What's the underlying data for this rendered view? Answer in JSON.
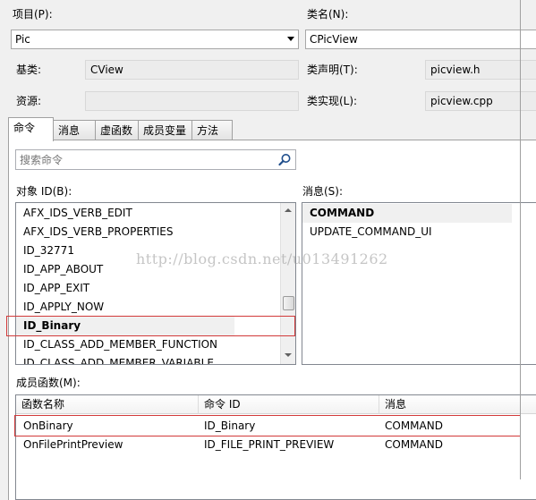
{
  "project": {
    "label": "项目(P):",
    "value": "Pic"
  },
  "class_name": {
    "label": "类名(N):",
    "value": "CPicView"
  },
  "base_class": {
    "label": "基类:",
    "value": "CView"
  },
  "class_decl": {
    "label": "类声明(T):",
    "value": "picview.h"
  },
  "resource": {
    "label": "资源:",
    "value": ""
  },
  "class_impl": {
    "label": "类实现(L):",
    "value": "picview.cpp"
  },
  "tabs": [
    {
      "label": "命令",
      "active": true
    },
    {
      "label": "消息"
    },
    {
      "label": "虚函数"
    },
    {
      "label": "成员变量"
    },
    {
      "label": "方法"
    }
  ],
  "search": {
    "placeholder": "搜索命令"
  },
  "object_ids": {
    "label": "对象 ID(B):",
    "items": [
      "AFX_IDS_VERB_EDIT",
      "AFX_IDS_VERB_PROPERTIES",
      "ID_32771",
      "ID_APP_ABOUT",
      "ID_APP_EXIT",
      "ID_APPLY_NOW",
      "ID_Binary",
      "ID_CLASS_ADD_MEMBER_FUNCTION",
      "ID_CLASS_ADD_MEMBER_VARIABLE"
    ],
    "selected": "ID_Binary"
  },
  "messages": {
    "label": "消息(S):",
    "items": [
      "COMMAND",
      "UPDATE_COMMAND_UI"
    ],
    "selected": "COMMAND"
  },
  "member_functions": {
    "label": "成员函数(M):",
    "columns": [
      "函数名称",
      "命令 ID",
      "消息"
    ],
    "rows": [
      [
        "OnBinary",
        "ID_Binary",
        "COMMAND"
      ],
      [
        "OnFilePrintPreview",
        "ID_FILE_PRINT_PREVIEW",
        "COMMAND"
      ]
    ]
  },
  "watermark": "http://blog.csdn.net/u013491262",
  "colors": {
    "highlight_box": "#d23a3a",
    "selection_bg": "#f0f0f0"
  }
}
